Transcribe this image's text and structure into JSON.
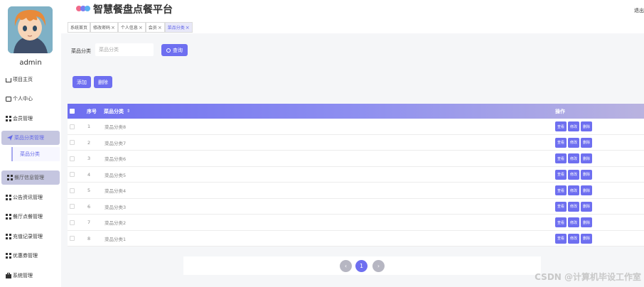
{
  "app": {
    "title": "智慧餐盘点餐平台",
    "logout": "退出"
  },
  "user": {
    "name": "admin"
  },
  "sidebar": {
    "items": [
      {
        "label": "项目主页",
        "icon": "home-icon"
      },
      {
        "label": "个人中心",
        "icon": "card-icon"
      },
      {
        "label": "会员管理",
        "icon": "grid-icon"
      },
      {
        "label": "菜品分类管理",
        "icon": "send-icon",
        "active": true
      },
      {
        "label": "菜品分类",
        "icon": "",
        "sub": true
      },
      {
        "label": "餐厅信息管理",
        "icon": "grid-icon",
        "active": true
      },
      {
        "label": "公告资讯管理",
        "icon": "grid-icon"
      },
      {
        "label": "餐厅点餐管理",
        "icon": "grid-icon"
      },
      {
        "label": "充值记录管理",
        "icon": "grid-icon"
      },
      {
        "label": "优惠券管理",
        "icon": "grid-icon"
      },
      {
        "label": "系统管理",
        "icon": "briefcase-icon"
      }
    ]
  },
  "tabs": [
    {
      "label": "系统首页",
      "closable": false
    },
    {
      "label": "修改密码",
      "closable": true
    },
    {
      "label": "个人信息",
      "closable": true
    },
    {
      "label": "会员",
      "closable": true
    },
    {
      "label": "菜品分类",
      "closable": true,
      "active": true
    }
  ],
  "search": {
    "label": "菜品分类",
    "placeholder": "菜品分类",
    "button": "查询"
  },
  "actions": {
    "add": "添加",
    "delete": "删除"
  },
  "table": {
    "headers": {
      "index": "序号",
      "name": "菜品分类",
      "sort": "⇕",
      "ops": "操作"
    },
    "rows": [
      {
        "index": "1",
        "name": "菜品分类8"
      },
      {
        "index": "2",
        "name": "菜品分类7"
      },
      {
        "index": "3",
        "name": "菜品分类6"
      },
      {
        "index": "4",
        "name": "菜品分类5"
      },
      {
        "index": "5",
        "name": "菜品分类4"
      },
      {
        "index": "6",
        "name": "菜品分类3"
      },
      {
        "index": "7",
        "name": "菜品分类2"
      },
      {
        "index": "8",
        "name": "菜品分类1"
      }
    ],
    "row_actions": [
      "查看",
      "修改",
      "删除"
    ]
  },
  "pagination": {
    "prev": "‹",
    "current": "1",
    "next": "›"
  },
  "watermark": "CSDN @计算机毕设工作室",
  "colors": {
    "accent": "#6e6ff0",
    "active_bg": "#c5c6e0"
  }
}
